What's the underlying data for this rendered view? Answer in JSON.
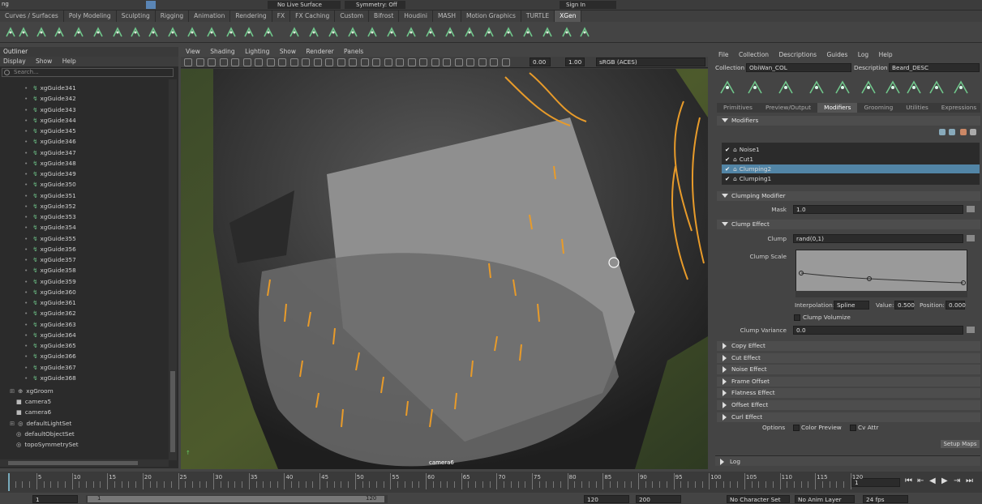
{
  "topbar": {
    "left": "ng",
    "surface": "No Live Surface",
    "symmetry": "Symmetry: Off",
    "signin": "Sign In"
  },
  "shelf_tabs": [
    {
      "label": "Curves / Surfaces"
    },
    {
      "label": "Poly Modeling"
    },
    {
      "label": "Sculpting"
    },
    {
      "label": "Rigging"
    },
    {
      "label": "Animation"
    },
    {
      "label": "Rendering"
    },
    {
      "label": "FX"
    },
    {
      "label": "FX Caching"
    },
    {
      "label": "Custom"
    },
    {
      "label": "Bifrost"
    },
    {
      "label": "Houdini"
    },
    {
      "label": "MASH"
    },
    {
      "label": "Motion Graphics"
    },
    {
      "label": "TURTLE"
    },
    {
      "label": "XGen"
    }
  ],
  "outliner": {
    "title": "Outliner",
    "menu": [
      "Display",
      "Show",
      "Help"
    ],
    "search_placeholder": "Search...",
    "guides": [
      "xgGuide341",
      "xgGuide342",
      "xgGuide343",
      "xgGuide344",
      "xgGuide345",
      "xgGuide346",
      "xgGuide347",
      "xgGuide348",
      "xgGuide349",
      "xgGuide350",
      "xgGuide351",
      "xgGuide352",
      "xgGuide353",
      "xgGuide354",
      "xgGuide355",
      "xgGuide356",
      "xgGuide357",
      "xgGuide358",
      "xgGuide359",
      "xgGuide360",
      "xgGuide361",
      "xgGuide362",
      "xgGuide363",
      "xgGuide364",
      "xgGuide365",
      "xgGuide366",
      "xgGuide367",
      "xgGuide368"
    ],
    "others": [
      "xgGroom",
      "camera5",
      "camera6",
      "defaultLightSet",
      "defaultObjectSet",
      "topoSymmetrySet"
    ]
  },
  "viewport": {
    "menu": [
      "View",
      "Shading",
      "Lighting",
      "Show",
      "Renderer",
      "Panels"
    ],
    "exposure": "0.00",
    "gamma": "1.00",
    "colorspace": "sRGB (ACES)",
    "camera_label": "camera6"
  },
  "xgen": {
    "menu": [
      "File",
      "Collection",
      "Descriptions",
      "Guides",
      "Log",
      "Help"
    ],
    "collection_label": "Collection",
    "collection": "ObiWan_COL",
    "description_label": "Description",
    "description": "Beard_DESC",
    "tabs": [
      "Primitives",
      "Preview/Output",
      "Modifiers",
      "Grooming",
      "Utilities",
      "Expressions"
    ],
    "active_tab": "Modifiers",
    "modifiers_header": "Modifiers",
    "modifiers": [
      "Noise1",
      "Cut1",
      "Clumping2",
      "Clumping1"
    ],
    "selected_modifier": "Clumping2",
    "clumping_header": "Clumping Modifier",
    "mask_label": "Mask",
    "mask_value": "1.0",
    "clump_effect_header": "Clump Effect",
    "clump_label": "Clump",
    "clump_value": "rand(0,1)",
    "clump_scale_label": "Clump Scale",
    "interpolation_label": "Interpolation:",
    "interpolation": "Spline",
    "value_label": "Value:",
    "value": "0.500",
    "position_label": "Position:",
    "position": "0.000",
    "clump_volumize": "Clump Volumize",
    "clump_variance_label": "Clump Variance",
    "clump_variance": "0.0",
    "effects": [
      "Copy Effect",
      "Cut Effect",
      "Noise Effect",
      "Frame Offset",
      "Flatness Effect",
      "Offset Effect",
      "Curl Effect"
    ],
    "options_label": "Options",
    "color_preview": "Color Preview",
    "cv_attr": "Cv Attr",
    "setup_maps": "Setup Maps",
    "log": "Log"
  },
  "timeline": {
    "ticks": [
      "5",
      "10",
      "15",
      "20",
      "25",
      "30",
      "35",
      "40",
      "45",
      "50",
      "55",
      "60",
      "65",
      "70",
      "75",
      "80",
      "85",
      "90",
      "95",
      "100",
      "105",
      "110",
      "115",
      "120"
    ],
    "current_frame": "1",
    "start": "1",
    "range_start": "1",
    "range_end": "120",
    "end": "120",
    "end2": "200",
    "character_set": "No Character Set",
    "anim_layer": "No Anim Layer",
    "fps": "24 fps"
  }
}
